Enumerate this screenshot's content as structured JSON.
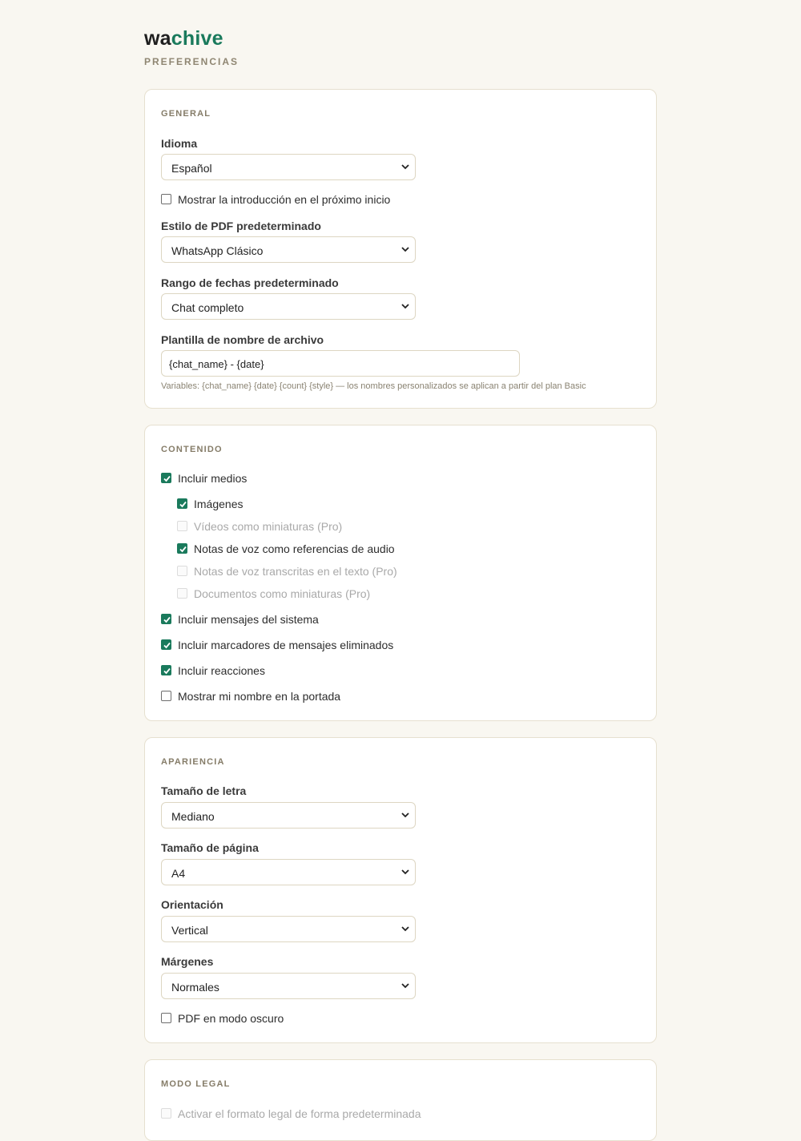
{
  "brand": {
    "part1": "wa",
    "part2": "chive",
    "subtitle": "PREFERENCIAS"
  },
  "colors": {
    "accent": "#1a7a5c",
    "background": "#f9f7f1"
  },
  "general": {
    "title": "GENERAL",
    "language_label": "Idioma",
    "language_value": "Español",
    "show_intro_label": "Mostrar la introducción en el próximo inicio",
    "show_intro_checked": false,
    "pdf_style_label": "Estilo de PDF predeterminado",
    "pdf_style_value": "WhatsApp Clásico",
    "date_range_label": "Rango de fechas predeterminado",
    "date_range_value": "Chat completo",
    "filename_label": "Plantilla de nombre de archivo",
    "filename_value": "{chat_name} - {date}",
    "filename_hint": "Variables: {chat_name} {date} {count} {style} — los nombres personalizados se aplican a partir del plan Basic"
  },
  "content": {
    "title": "CONTENIDO",
    "include_media": "Incluir medios",
    "images": "Imágenes",
    "videos_thumbs": "Vídeos como miniaturas (Pro)",
    "voice_refs": "Notas de voz como referencias de audio",
    "voice_transcribed": "Notas de voz transcritas en el texto (Pro)",
    "docs_thumbs": "Documentos como miniaturas (Pro)",
    "system_messages": "Incluir mensajes del sistema",
    "deleted_markers": "Incluir marcadores de mensajes eliminados",
    "reactions": "Incluir reacciones",
    "show_name_cover": "Mostrar mi nombre en la portada"
  },
  "appearance": {
    "title": "APARIENCIA",
    "font_size_label": "Tamaño de letra",
    "font_size_value": "Mediano",
    "page_size_label": "Tamaño de página",
    "page_size_value": "A4",
    "orientation_label": "Orientación",
    "orientation_value": "Vertical",
    "margins_label": "Márgenes",
    "margins_value": "Normales",
    "dark_pdf_label": "PDF en modo oscuro"
  },
  "legal": {
    "title": "MODO LEGAL",
    "enable_legal": "Activar el formato legal de forma predeterminada"
  },
  "icons": {
    "select_arrow": "chevron-down-icon",
    "check": "checkmark-icon"
  }
}
